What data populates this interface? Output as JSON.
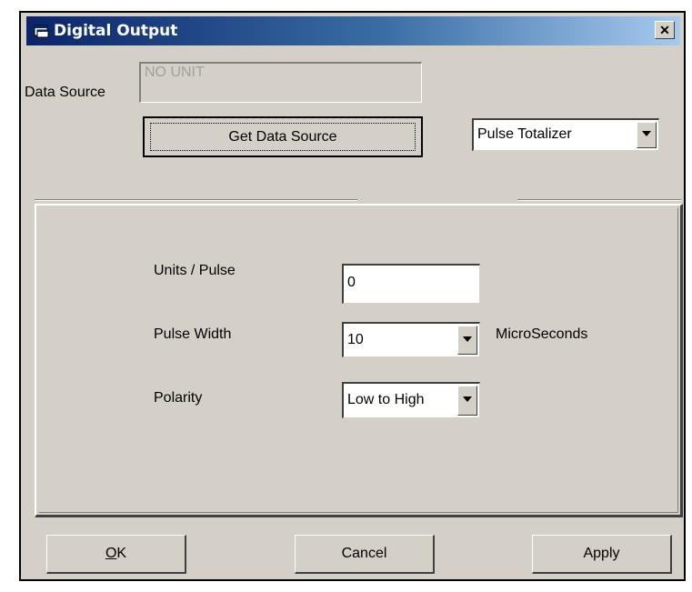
{
  "window": {
    "title": "Digital Output",
    "close_symbol": "✕",
    "icon": "app-window-icon"
  },
  "data_source": {
    "label": "Data Source",
    "value": "NO UNIT",
    "get_button_label": "Get Data Source"
  },
  "mode_dropdown": {
    "selected": "Pulse Totalizer"
  },
  "settings": {
    "units_per_pulse": {
      "label": "Units / Pulse",
      "value": "0"
    },
    "pulse_width": {
      "label": "Pulse Width",
      "selected": "10",
      "unit": "MicroSeconds"
    },
    "polarity": {
      "label": "Polarity",
      "selected": "Low to High"
    }
  },
  "buttons": {
    "ok_mnemonic": "O",
    "ok_rest": "K",
    "cancel": "Cancel",
    "apply": "Apply"
  }
}
